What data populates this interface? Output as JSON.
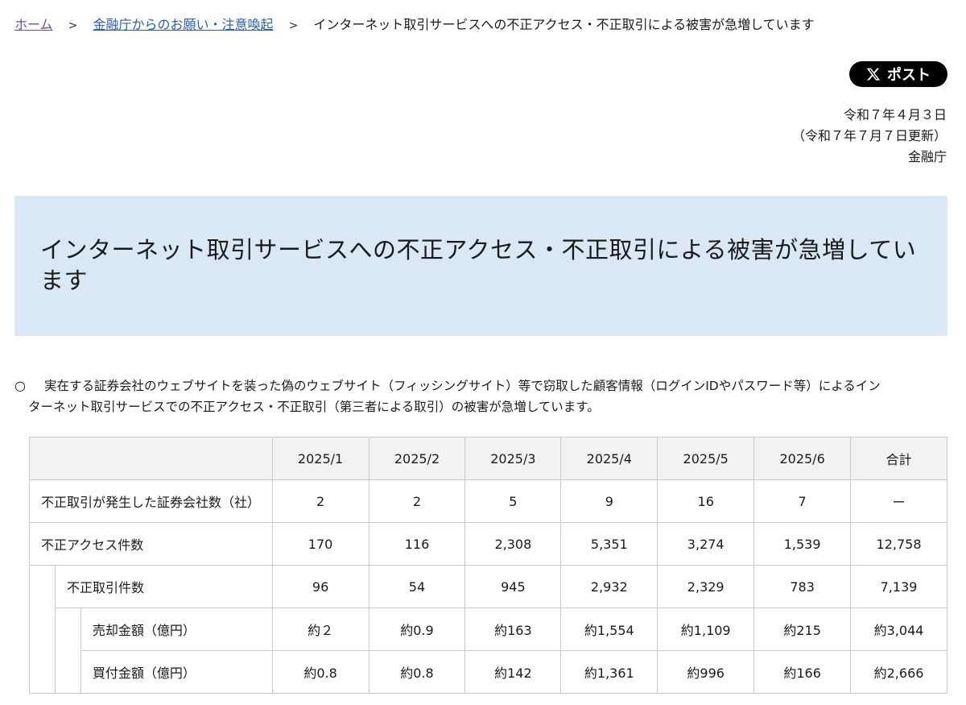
{
  "breadcrumb": {
    "home": "ホーム",
    "parent": "金融庁からのお願い・注意喚起",
    "current": "インターネット取引サービスへの不正アクセス・不正取引による被害が急増しています",
    "separator": ">"
  },
  "share": {
    "post_label": "ポスト"
  },
  "meta": {
    "date": "令和７年４月３日",
    "updated": "（令和７年７月７日更新）",
    "agency": "金融庁"
  },
  "title": "インターネット取引サービスへの不正アクセス・不正取引による被害が急増しています",
  "notice": {
    "bullet": "○",
    "line1": "実在する証券会社のウェブサイトを装った偽のウェブサイト（フィッシングサイト）等で窃取した顧客情報（ログインIDやパスワード等）によるイン",
    "line2": "ターネット取引サービスでの不正アクセス・不正取引（第三者による取引）の被害が急増しています。"
  },
  "table": {
    "headers": [
      "2025/1",
      "2025/2",
      "2025/3",
      "2025/4",
      "2025/5",
      "2025/6",
      "合計"
    ],
    "rows": [
      {
        "label": "不正取引が発生した証券会社数（社）",
        "level": 0,
        "values": [
          "2",
          "2",
          "5",
          "9",
          "16",
          "7",
          "ー"
        ]
      },
      {
        "label": "不正アクセス件数",
        "level": 0,
        "values": [
          "170",
          "116",
          "2,308",
          "5,351",
          "3,274",
          "1,539",
          "12,758"
        ]
      },
      {
        "label": "不正取引件数",
        "level": 1,
        "values": [
          "96",
          "54",
          "945",
          "2,932",
          "2,329",
          "783",
          "7,139"
        ]
      },
      {
        "label": "売却金額（億円）",
        "level": 2,
        "values": [
          "約２",
          "約0.9",
          "約163",
          "約1,554",
          "約1,109",
          "約215",
          "約3,044"
        ]
      },
      {
        "label": "買付金額（億円）",
        "level": 2,
        "values": [
          "約0.8",
          "約0.8",
          "約142",
          "約1,361",
          "約996",
          "約166",
          "約2,666"
        ]
      }
    ]
  }
}
